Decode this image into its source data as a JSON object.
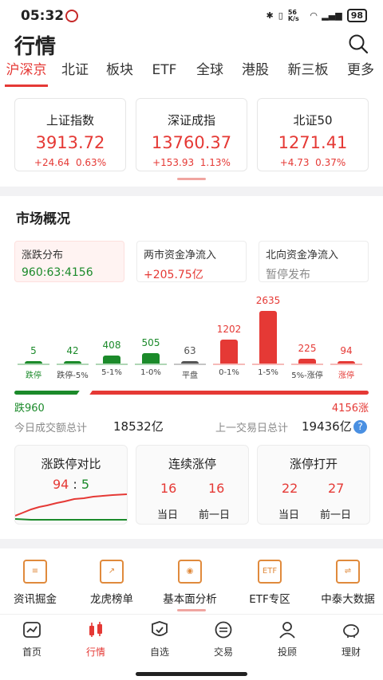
{
  "status": {
    "time": "05:32",
    "net": "56 K/s",
    "battery": "98"
  },
  "header": {
    "title": "行情"
  },
  "tabs": [
    "沪深京",
    "北证",
    "板块",
    "ETF",
    "全球",
    "港股",
    "新三板",
    "更多"
  ],
  "indices": [
    {
      "name": "上证指数",
      "value": "3913.72",
      "change": "+24.64",
      "pct": "0.63%"
    },
    {
      "name": "深证成指",
      "value": "13760.37",
      "change": "+153.93",
      "pct": "1.13%"
    },
    {
      "name": "北证50",
      "value": "1271.41",
      "change": "+4.73",
      "pct": "0.37%"
    }
  ],
  "market": {
    "title": "市场概况",
    "stats": [
      {
        "label": "涨跌分布",
        "value": "960:63:4156"
      },
      {
        "label": "两市资金净流入",
        "value": "+205.75亿"
      },
      {
        "label": "北向资金净流入",
        "value": "暂停发布"
      }
    ],
    "distribution": [
      {
        "label": "跌停",
        "value": 5,
        "color": "#1b8a2a"
      },
      {
        "label": "跌停-5%",
        "value": 42,
        "color": "#1b8a2a"
      },
      {
        "label": "5-1%",
        "value": 408,
        "color": "#1b8a2a"
      },
      {
        "label": "1-0%",
        "value": 505,
        "color": "#1b8a2a"
      },
      {
        "label": "平盘",
        "value": 63,
        "color": "#555555"
      },
      {
        "label": "0-1%",
        "value": 1202,
        "color": "#e53935"
      },
      {
        "label": "1-5%",
        "value": 2635,
        "color": "#e53935"
      },
      {
        "label": "5%-涨停",
        "value": 225,
        "color": "#e53935"
      },
      {
        "label": "涨停",
        "value": 94,
        "color": "#e53935"
      }
    ],
    "down_label": "跌960",
    "up_label": "4156涨",
    "today_label": "今日成交额总计",
    "today_value": "18532亿",
    "prev_label": "上一交易日总计",
    "prev_value": "19436亿",
    "cards": {
      "limit": {
        "title": "涨跌停对比",
        "up": "94",
        "sep": ":",
        "down": "5"
      },
      "continuous": {
        "title": "连续涨停",
        "today": "16",
        "prev": "16",
        "today_label": "当日",
        "prev_label": "前一日"
      },
      "broken": {
        "title": "涨停打开",
        "today": "22",
        "prev": "27",
        "today_label": "当日",
        "prev_label": "前一日"
      }
    }
  },
  "shortcuts": [
    "资讯掘金",
    "龙虎榜单",
    "基本面分析",
    "ETF专区",
    "中泰大数据"
  ],
  "nav": [
    "首页",
    "行情",
    "自选",
    "交易",
    "投顾",
    "理财"
  ],
  "colors": {
    "accent": "#e53935",
    "green": "#1b8a2a"
  }
}
